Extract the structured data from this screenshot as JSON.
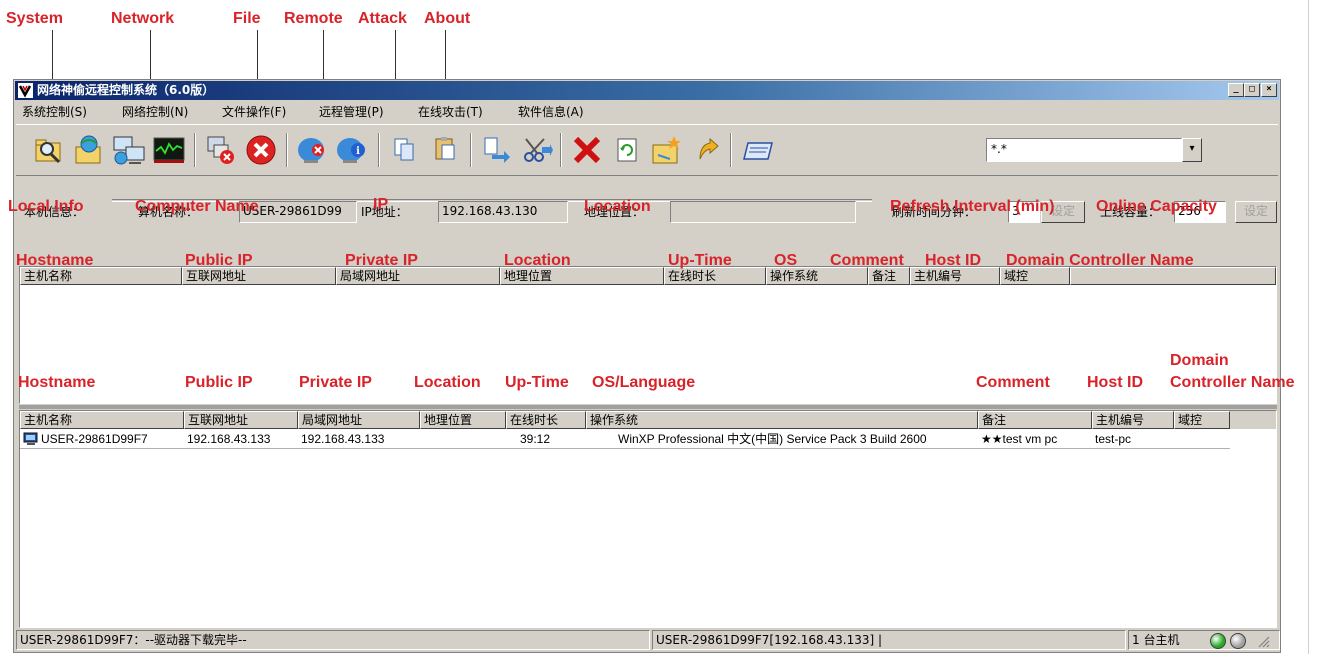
{
  "annotations": {
    "toolbar": [
      "System",
      "Network",
      "File",
      "Remote",
      "Attack",
      "About"
    ],
    "local_info": {
      "local_info": "Local Info",
      "computer_name": "Computer Name",
      "ip": "IP",
      "location": "Location",
      "refresh": "Refresh Interval (min)",
      "capacity": "Online Capacity"
    },
    "upper_columns": [
      "Hostname",
      "Public IP",
      "Private IP",
      "Location",
      "Up-Time",
      "OS",
      "Comment",
      "Host ID",
      "Domain Controller Name"
    ],
    "lower_columns": [
      "Hostname",
      "Public IP",
      "Private IP",
      "Location",
      "Up-Time",
      "OS/Language",
      "Comment",
      "Host ID"
    ],
    "lower_domain_line1": "Domain",
    "lower_domain_line2": "Controller Name"
  },
  "window": {
    "title": "网络神偷远程控制系统（6.0版）",
    "controls": [
      "_",
      "□",
      "×"
    ]
  },
  "menu": [
    "系统控制(S)",
    "网络控制(N)",
    "文件操作(F)",
    "远程管理(P)",
    "在线攻击(T)",
    "软件信息(A)"
  ],
  "toolbar_icons": [
    "system-search-icon",
    "network-folder-icon",
    "network-computer-icon",
    "monitor-graph-icon",
    "remote-disconnect-icon",
    "stop-icon",
    "attack-globe-icon",
    "about-globe-icon",
    "copy-icon",
    "paste-icon",
    "move-icon",
    "cut-icon",
    "delete-icon",
    "refresh-icon",
    "folder-star-icon",
    "upload-icon",
    "window-icon"
  ],
  "combo": {
    "value": "*.*",
    "arrow": "▾"
  },
  "local_info": {
    "label": "本机信息：",
    "computer_name_label": "算机名称：",
    "computer_name": "USER-29861D99",
    "ip_label": "IP地址：",
    "ip": "192.168.43.130",
    "location_label": "地理位置：",
    "location": "",
    "refresh_label": "刷新时间分钟：",
    "refresh_value": "3",
    "refresh_set": "设定",
    "capacity_label": "上线容量：",
    "capacity_value": "256",
    "capacity_set": "设定"
  },
  "upper_table": {
    "headers": [
      "主机名称",
      "互联网地址",
      "局域网地址",
      "地理位置",
      "在线时长",
      "操作系统",
      "备注",
      "主机编号",
      "域控"
    ]
  },
  "lower_table": {
    "headers": [
      "主机名称",
      "互联网地址",
      "局域网地址",
      "地理位置",
      "在线时长",
      "操作系统",
      "备注",
      "主机编号",
      "域控"
    ],
    "rows": [
      {
        "hostname": "USER-29861D99F7",
        "public_ip": "192.168.43.133",
        "private_ip": "192.168.43.133",
        "location": "",
        "uptime": "39:12",
        "os": "WinXP Professional 中文(中国) Service Pack 3 Build 2600",
        "comment": "★★test vm pc",
        "host_id": "test-pc",
        "domain": ""
      }
    ]
  },
  "status": {
    "left": "USER-29861D99F7：--驱动器下载完毕--",
    "middle": "USER-29861D99F7[192.168.43.133] |",
    "count": "1 台主机",
    "led_colors": [
      "#22aa22",
      "#a0a0a0"
    ]
  }
}
